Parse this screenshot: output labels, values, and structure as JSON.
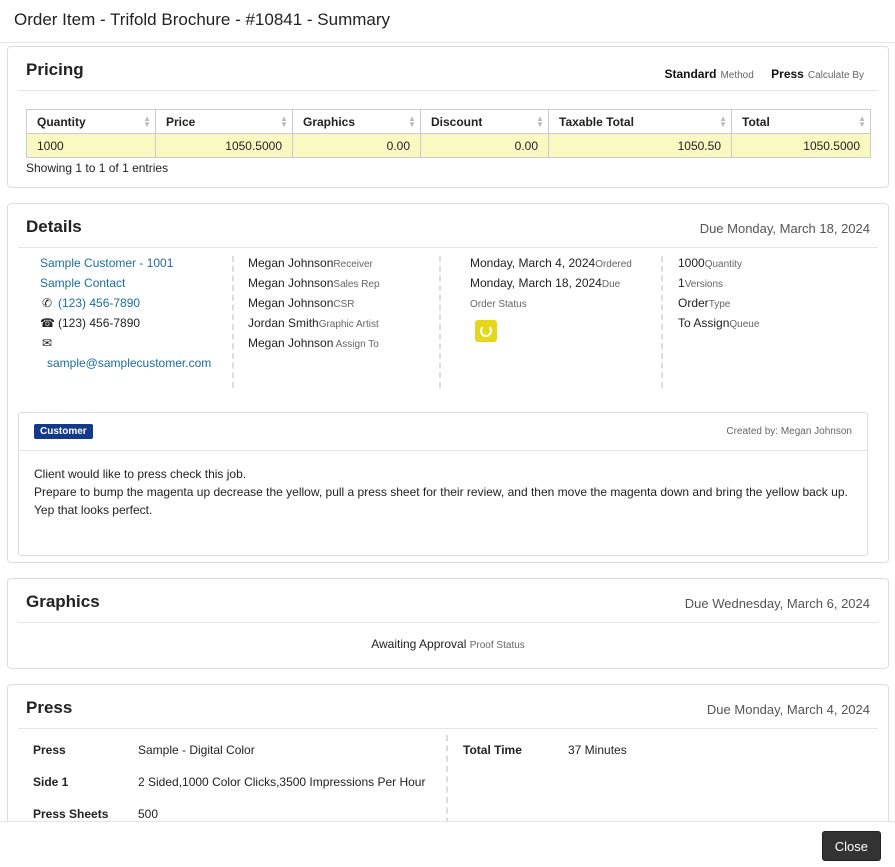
{
  "modal": {
    "title": "Order Item - Trifold Brochure - #10841 - Summary",
    "close_label": "Close"
  },
  "pricing": {
    "title": "Pricing",
    "method_value": "Standard",
    "method_label": "Method",
    "calc_value": "Press",
    "calc_label": "Calculate By",
    "columns": [
      "Quantity",
      "Price",
      "Graphics",
      "Discount",
      "Taxable Total",
      "Total"
    ],
    "row": [
      "1000",
      "1050.5000",
      "0.00",
      "0.00",
      "1050.50",
      "1050.5000"
    ],
    "showing": "Showing 1 to 1 of 1 entries"
  },
  "details": {
    "title": "Details",
    "due": "Due Monday, March 18, 2024",
    "customer": "Sample Customer - 1001",
    "contact": "Sample Contact",
    "phone": "(123) 456-7890",
    "fax": "(123) 456-7890",
    "email": "sample@samplecustomer.com",
    "people": [
      {
        "name": "Megan Johnson",
        "role": "Receiver"
      },
      {
        "name": "Megan Johnson",
        "role": "Sales Rep"
      },
      {
        "name": "Megan Johnson",
        "role": "CSR"
      },
      {
        "name": "Jordan Smith",
        "role": "Graphic Artist"
      },
      {
        "name": "Megan Johnson",
        "role": " Assign To"
      }
    ],
    "ordered_date": "Monday, March 4, 2024",
    "ordered_label": "Ordered",
    "due_date": "Monday, March 18, 2024",
    "due_label": "Due",
    "order_status_label": "Order Status",
    "status_color": "#e5d81c",
    "quantity_value": "1000",
    "quantity_label": "Quantity",
    "versions_value": "1",
    "versions_label": "Versions",
    "type_value": "Order",
    "type_label": "Type",
    "queue_value": "To Assign",
    "queue_label": "Queue",
    "note": {
      "badge": "Customer",
      "created_by": "Created by: Megan Johnson",
      "line1": "Client would like to press check this job.",
      "line2": "Prepare to bump the magenta up decrease the yellow, pull a press sheet for their review, and then move the magenta down and bring the yellow back up.",
      "line3": "Yep that looks perfect."
    }
  },
  "graphics": {
    "title": "Graphics",
    "due": "Due Wednesday, March 6, 2024",
    "proof_value": "Awaiting Approval",
    "proof_label": "Proof Status"
  },
  "press": {
    "title": "Press",
    "due": "Due Monday, March 4, 2024",
    "press_label": "Press",
    "press_value": "Sample - Digital Color",
    "side_label": "Side 1",
    "side_value": "2 Sided,1000 Color Clicks,3500 Impressions Per Hour",
    "sheets_label": "Press Sheets",
    "sheets_value": "500",
    "time_label": "Total Time",
    "time_value": "37 Minutes"
  }
}
